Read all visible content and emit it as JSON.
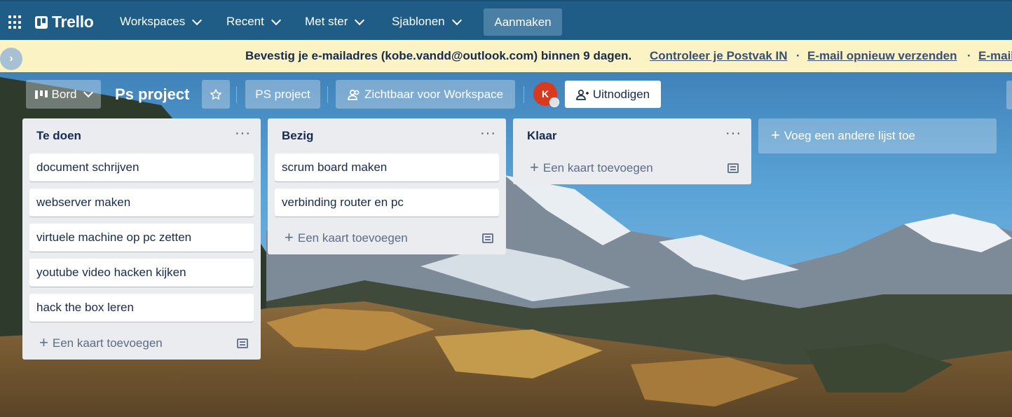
{
  "nav": {
    "app_name": "Trello",
    "items": [
      {
        "label": "Workspaces"
      },
      {
        "label": "Recent"
      },
      {
        "label": "Met ster"
      },
      {
        "label": "Sjablonen"
      }
    ],
    "create_label": "Aanmaken"
  },
  "banner": {
    "message": "Bevestig je e-mailadres (kobe.vandd@outlook.com) binnen 9 dagen.",
    "link_inbox": "Controleer je Postvak IN",
    "link_resend": "E-mail opnieuw verzenden",
    "link_more": "E-mail",
    "separator": "·"
  },
  "board": {
    "view_label": "Bord",
    "title": "Ps project",
    "workspace_label": "PS project",
    "visibility_label": "Zichtbaar voor Workspace",
    "avatar_initial": "K",
    "invite_label": "Uitnodigen",
    "menu_glyph": "···",
    "add_card_label": "Een kaart toevoegen",
    "add_list_label": "Voeg een andere lijst toe"
  },
  "lists": [
    {
      "title": "Te doen",
      "cards": [
        "document schrijven",
        "webserver maken",
        "virtuele machine op pc zetten",
        "youtube video hacken kijken",
        "hack the box leren"
      ]
    },
    {
      "title": "Bezig",
      "cards": [
        "scrum board maken",
        "verbinding router en pc"
      ]
    },
    {
      "title": "Klaar",
      "cards": []
    }
  ],
  "colors": {
    "nav_bg": "#1f5d87",
    "banner_bg": "#fbf3c4",
    "list_bg": "#ebecf0",
    "avatar_bg": "#d83a1e"
  }
}
